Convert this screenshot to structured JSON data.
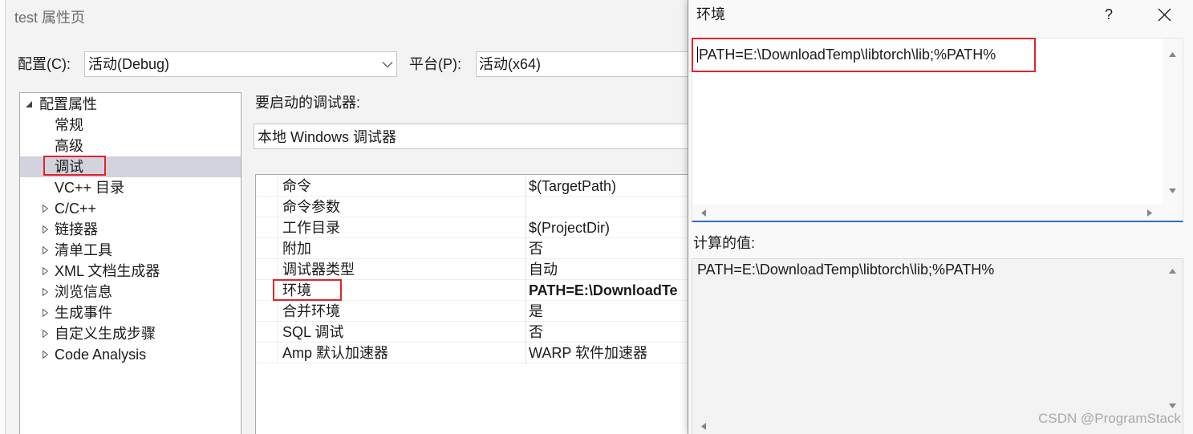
{
  "main_window": {
    "title": "test 属性页",
    "config_label": "配置(C):",
    "config_value": "活动(Debug)",
    "platform_label": "平台(P):",
    "platform_value": "活动(x64)",
    "dropdown_icon": "chevron-down-icon"
  },
  "tree": {
    "items": [
      {
        "label": "配置属性",
        "icon": "expanded-arrow-icon"
      },
      {
        "label": "常规"
      },
      {
        "label": "高级"
      },
      {
        "label": "调试",
        "selected": true
      },
      {
        "label": "VC++ 目录"
      },
      {
        "label": "C/C++",
        "icon": "collapsed-arrow-icon"
      },
      {
        "label": "链接器",
        "icon": "collapsed-arrow-icon"
      },
      {
        "label": "清单工具",
        "icon": "collapsed-arrow-icon"
      },
      {
        "label": "XML 文档生成器",
        "icon": "collapsed-arrow-icon"
      },
      {
        "label": "浏览信息",
        "icon": "collapsed-arrow-icon"
      },
      {
        "label": "生成事件",
        "icon": "collapsed-arrow-icon"
      },
      {
        "label": "自定义生成步骤",
        "icon": "collapsed-arrow-icon"
      },
      {
        "label": "Code Analysis",
        "icon": "collapsed-arrow-icon"
      }
    ]
  },
  "debugger": {
    "label": "要启动的调试器:",
    "value": "本地 Windows 调试器"
  },
  "properties": {
    "rows": [
      {
        "name": "命令",
        "value": "$(TargetPath)"
      },
      {
        "name": "命令参数",
        "value": ""
      },
      {
        "name": "工作目录",
        "value": "$(ProjectDir)"
      },
      {
        "name": "附加",
        "value": "否"
      },
      {
        "name": "调试器类型",
        "value": "自动"
      },
      {
        "name": "环境",
        "value": "PATH=E:\\DownloadTe",
        "modified": true
      },
      {
        "name": "合并环境",
        "value": "是"
      },
      {
        "name": "SQL 调试",
        "value": "否"
      },
      {
        "name": "Amp 默认加速器",
        "value": "WARP 软件加速器"
      }
    ]
  },
  "env_dialog": {
    "title": "环境",
    "help_label": "?",
    "close_icon": "close-icon",
    "edit_value": "PATH=E:\\DownloadTemp\\libtorch\\lib;%PATH%",
    "evaluated_label": "计算的值:",
    "evaluated_value": "PATH=E:\\DownloadTemp\\libtorch\\lib;%PATH%"
  },
  "watermark": "CSDN @ProgramStack",
  "colors": {
    "annotation_red": "#e2232a",
    "selection_bg": "#d3d3de",
    "focus_accent": "#2c6fc0"
  }
}
